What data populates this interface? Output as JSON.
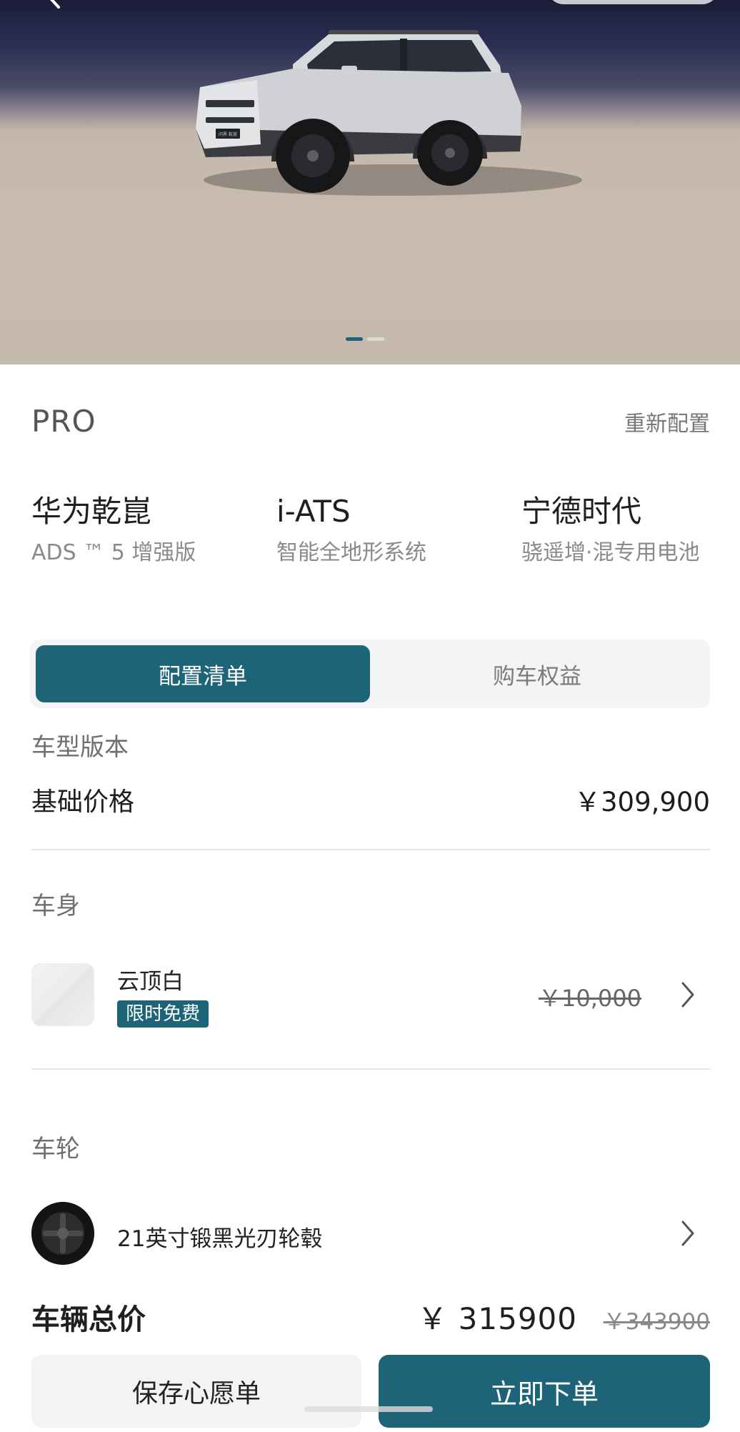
{
  "hero": {
    "slides_total": 2,
    "active_slide": 1,
    "plate_text": "问界 乾崑",
    "colors": {
      "sky": "#1a1c38",
      "ground": "#c6b9ad",
      "accent": "#1e6478"
    }
  },
  "trim": {
    "name": "PRO",
    "reconfigure_label": "重新配置"
  },
  "features": [
    {
      "title": "华为乾崑",
      "subtitle": "ADS ™ 5 增强版"
    },
    {
      "title": "i-ATS",
      "subtitle": "智能全地形系统"
    },
    {
      "title": "宁德时代",
      "subtitle": "骁遥增·混专用电池"
    }
  ],
  "tabs": [
    {
      "label": "配置清单",
      "active": true
    },
    {
      "label": "购车权益",
      "active": false
    }
  ],
  "version": {
    "section_label": "车型版本",
    "base_price_label": "基础价格",
    "base_price": "￥309,900"
  },
  "body": {
    "section_label": "车身",
    "color_name": "云顶白",
    "badge": "限时免费",
    "original_price": "￥10,000"
  },
  "wheels": {
    "section_label": "车轮",
    "name": "21英寸锻黑光刃轮毂"
  },
  "summary": {
    "total_label": "车辆总价",
    "total_price": "￥ 315900",
    "original_total": "￥343900",
    "save_wishlist": "保存心愿单",
    "order_now": "立即下单"
  },
  "icons": {
    "back": "chevron-left-icon",
    "chevron": "chevron-right-icon",
    "swatch": "color-swatch-icon",
    "wheel": "wheel-icon"
  }
}
